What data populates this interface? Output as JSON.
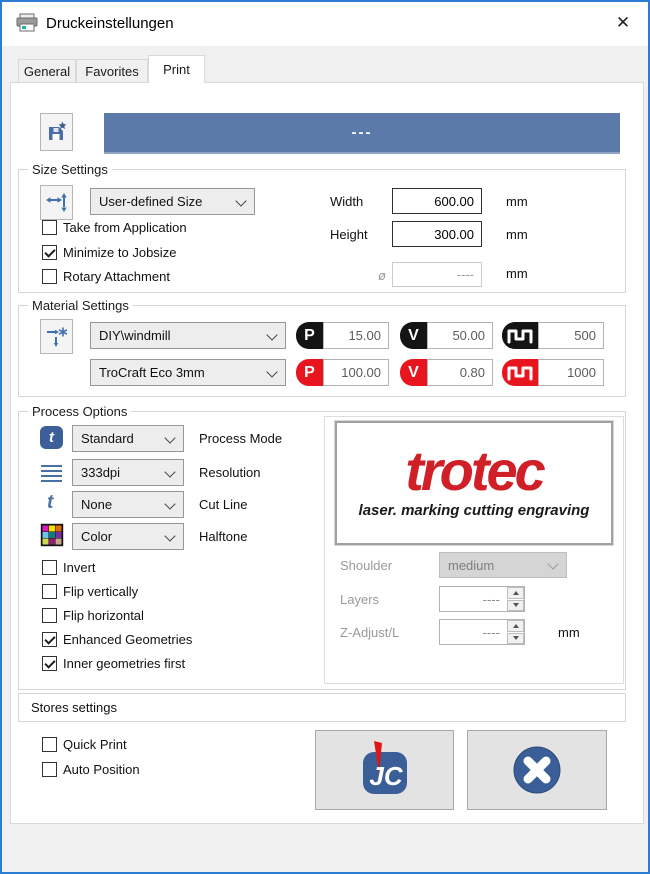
{
  "window": {
    "title": "Druckeinstellungen",
    "close_glyph": "✕"
  },
  "tabs": {
    "general": "General",
    "favorites": "Favorites",
    "print": "Print"
  },
  "favorites_bar": {
    "value": "---"
  },
  "size_settings": {
    "title": "Size Settings",
    "preset": "User-defined Size",
    "width_label": "Width",
    "width_value": "600.00",
    "width_unit": "mm",
    "height_label": "Height",
    "height_value": "300.00",
    "height_unit": "mm",
    "take_from_application": {
      "label": "Take from Application",
      "checked": false
    },
    "minimize_to_jobsize": {
      "label": "Minimize to Jobsize",
      "checked": true
    },
    "rotary_attachment": {
      "label": "Rotary Attachment",
      "checked": false
    },
    "diameter_symbol": "ø",
    "diameter_value": "----",
    "diameter_unit": "mm"
  },
  "material_settings": {
    "title": "Material Settings",
    "power_glyph": "P",
    "speed_glyph": "V",
    "engrave": {
      "material": "DIY\\windmill",
      "power": "15.00",
      "speed": "50.00",
      "ppi": "500"
    },
    "cut": {
      "material": "TroCraft Eco 3mm",
      "power": "100.00",
      "speed": "0.80",
      "ppi": "1000"
    }
  },
  "process_options": {
    "title": "Process Options",
    "process_mode": {
      "value": "Standard",
      "label": "Process Mode"
    },
    "resolution": {
      "value": "333dpi",
      "label": "Resolution"
    },
    "cut_line": {
      "value": "None",
      "label": "Cut Line"
    },
    "halftone": {
      "value": "Color",
      "label": "Halftone"
    },
    "invert": {
      "label": "Invert",
      "checked": false
    },
    "flip_vertically": {
      "label": "Flip vertically",
      "checked": false
    },
    "flip_horizontal": {
      "label": "Flip horizontal",
      "checked": false
    },
    "enhanced_geometries": {
      "label": "Enhanced Geometries",
      "checked": true
    },
    "inner_geometries_first": {
      "label": "Inner geometries first",
      "checked": true
    },
    "logo": {
      "brand": "trotec",
      "tagline": "laser. marking cutting engraving"
    },
    "shoulder": {
      "label": "Shoulder",
      "value": "medium"
    },
    "layers": {
      "label": "Layers",
      "value": "----"
    },
    "z_adjust": {
      "label": "Z-Adjust/L",
      "value": "----",
      "unit": "mm"
    }
  },
  "stores_settings": {
    "title": "Stores settings",
    "quick_print": {
      "label": "Quick Print",
      "checked": false
    },
    "auto_position": {
      "label": "Auto Position",
      "checked": false
    },
    "jc_glyph": "JC"
  },
  "icons": {
    "process_mode_glyph": "t",
    "cut_line_glyph": "t"
  },
  "colors": {
    "accent_blue": "#5b7aa9",
    "trotec_red": "#d01f26",
    "engrave_black": "#141414",
    "cut_red": "#e8141e"
  }
}
